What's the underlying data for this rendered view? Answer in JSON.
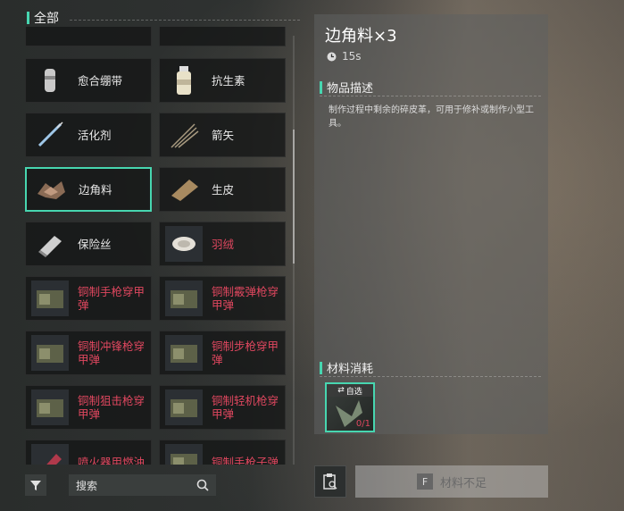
{
  "category": {
    "title": "全部"
  },
  "items": [
    {
      "label": "",
      "style": "normal",
      "icon": "partial-item-icon"
    },
    {
      "label": "",
      "style": "normal",
      "icon": "partial-item-icon"
    },
    {
      "label": "愈合绷带",
      "style": "normal",
      "icon": "bandage-icon"
    },
    {
      "label": "抗生素",
      "style": "normal",
      "icon": "antibiotic-bottle-icon"
    },
    {
      "label": "活化剂",
      "style": "normal",
      "icon": "syringe-icon"
    },
    {
      "label": "箭矢",
      "style": "normal",
      "icon": "arrows-icon"
    },
    {
      "label": "边角料",
      "style": "normal",
      "icon": "scraps-icon",
      "selected": true
    },
    {
      "label": "生皮",
      "style": "normal",
      "icon": "rawhide-icon"
    },
    {
      "label": "保险丝",
      "style": "normal",
      "icon": "fuse-icon"
    },
    {
      "label": "羽绒",
      "style": "red",
      "icon": "down-feather-icon"
    },
    {
      "label": "铜制手枪穿甲弹",
      "style": "red",
      "icon": "ammo-box-icon"
    },
    {
      "label": "铜制霰弹枪穿甲弹",
      "style": "red",
      "icon": "ammo-box-icon"
    },
    {
      "label": "铜制冲锋枪穿甲弹",
      "style": "red",
      "icon": "ammo-box-icon"
    },
    {
      "label": "铜制步枪穿甲弹",
      "style": "red",
      "icon": "ammo-box-icon"
    },
    {
      "label": "铜制狙击枪穿甲弹",
      "style": "red",
      "icon": "ammo-box-icon"
    },
    {
      "label": "铜制轻机枪穿甲弹",
      "style": "red",
      "icon": "ammo-box-icon"
    },
    {
      "label": "喷火器用燃油",
      "style": "red",
      "icon": "fuel-canister-icon"
    },
    {
      "label": "铜制手枪子弹",
      "style": "red",
      "icon": "ammo-box-icon"
    }
  ],
  "search": {
    "placeholder": "搜索"
  },
  "detail": {
    "title": "边角料×3",
    "time": "15s",
    "desc_header": "物品描述",
    "description": "制作过程中剩余的碎皮革，可用于修补或制作小型工具。",
    "materials_header": "材料消耗",
    "material": {
      "auto_label": "自选",
      "count": "0/1"
    }
  },
  "craft_button": {
    "key": "F",
    "label": "材料不足"
  },
  "colors": {
    "accent": "#47d6b0",
    "red_text": "#e0475f"
  }
}
